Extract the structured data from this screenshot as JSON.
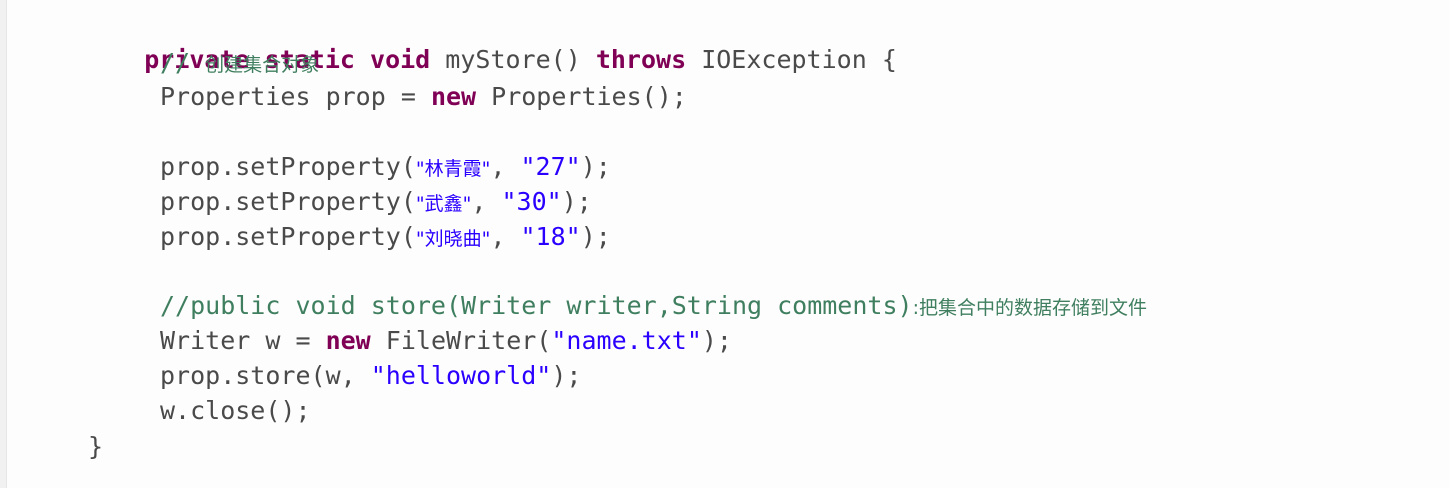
{
  "editor": {
    "lines": {
      "l1": {
        "kw_private": "private",
        "kw_static": "static",
        "kw_void": "void",
        "method": "myStore()",
        "kw_throws": "throws",
        "exception": "IOException {"
      },
      "l2": {
        "comment_prefix": "// ",
        "comment_text": "创建集合对象"
      },
      "l3": {
        "type": "Properties prop = ",
        "kw_new": "new",
        "ctor": " Properties();"
      },
      "l4": {
        "call": "prop.setProperty(",
        "key": "\"林青霞\"",
        "sep": ", ",
        "val": "\"27\"",
        "end": ");"
      },
      "l5": {
        "call": "prop.setProperty(",
        "key": "\"武鑫\"",
        "sep": ", ",
        "val": "\"30\"",
        "end": ");"
      },
      "l6": {
        "call": "prop.setProperty(",
        "key": "\"刘晓曲\"",
        "sep": ", ",
        "val": "\"18\"",
        "end": ");"
      },
      "l7": {
        "comment_code": "//public void store(Writer writer,String comments)",
        "comment_cjk": ":把集合中的数据存储到文件"
      },
      "l8": {
        "decl": "Writer w = ",
        "kw_new": "new",
        "ctor": " FileWriter(",
        "arg": "\"name.txt\"",
        "end": ");"
      },
      "l9": {
        "call": "prop.store(w, ",
        "arg": "\"helloworld\"",
        "end": ");"
      },
      "l10": {
        "stmt": "w.close();"
      },
      "l11": {
        "brace": "}"
      }
    }
  }
}
